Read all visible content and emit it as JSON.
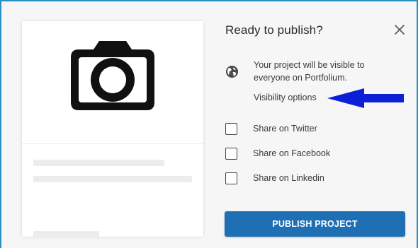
{
  "dialog": {
    "title": "Ready to publish?",
    "close_icon": "close-icon",
    "visibility": {
      "icon": "globe-icon",
      "text": "Your project will be visible to everyone on Portfolium.",
      "link_label": "Visibility options"
    },
    "share_options": [
      {
        "label": "Share on Twitter",
        "checked": false
      },
      {
        "label": "Share on Facebook",
        "checked": false
      },
      {
        "label": "Share on Linkedin",
        "checked": false
      }
    ],
    "publish_label": "PUBLISH PROJECT"
  },
  "preview_card": {
    "image_icon": "camera-icon"
  },
  "annotation": {
    "arrow_icon": "arrow-left-icon",
    "color": "#0a1fd6"
  },
  "colors": {
    "frame_border": "#2a8fc0",
    "primary_button": "#1f6fb4"
  }
}
